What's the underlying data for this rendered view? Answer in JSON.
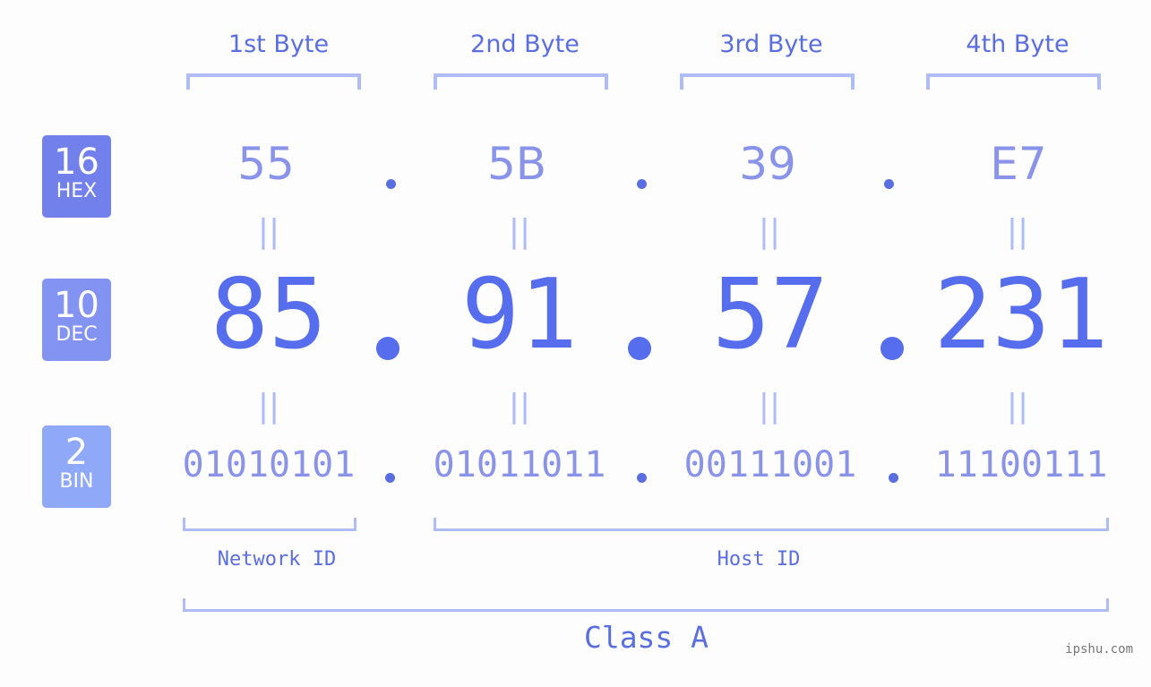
{
  "byte_headers": [
    "1st Byte",
    "2nd Byte",
    "3rd Byte",
    "4th Byte"
  ],
  "badges": [
    {
      "num": "16",
      "label": "HEX",
      "color": "#7280ec"
    },
    {
      "num": "10",
      "label": "DEC",
      "color": "#8393f1"
    },
    {
      "num": "2",
      "label": "BIN",
      "color": "#8fa8f8"
    }
  ],
  "hex": [
    "55",
    "5B",
    "39",
    "E7"
  ],
  "dec": [
    "85",
    "91",
    "57",
    "231"
  ],
  "bin": [
    "01010101",
    "01011011",
    "00111001",
    "11100111"
  ],
  "equals": "||",
  "network_label": "Network ID",
  "host_label": "Host ID",
  "class_label": "Class A",
  "watermark": "ipshu.com",
  "colors": {
    "accent": "#566ded",
    "light": "#b0bcf6",
    "muted": "#8a93ea"
  }
}
